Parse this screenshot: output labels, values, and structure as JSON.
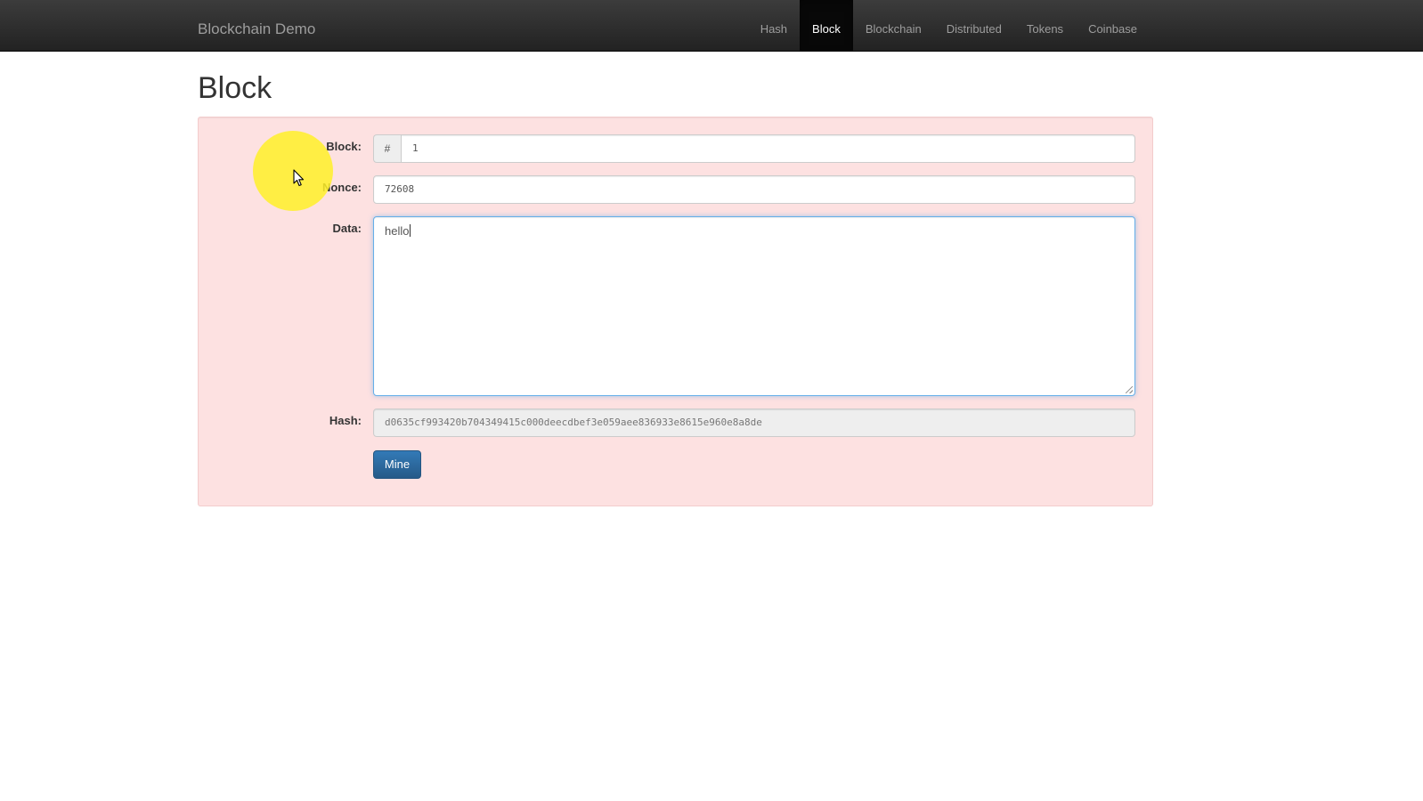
{
  "navbar": {
    "brand": "Blockchain Demo",
    "items": [
      {
        "label": "Hash",
        "active": false
      },
      {
        "label": "Block",
        "active": true
      },
      {
        "label": "Blockchain",
        "active": false
      },
      {
        "label": "Distributed",
        "active": false
      },
      {
        "label": "Tokens",
        "active": false
      },
      {
        "label": "Coinbase",
        "active": false
      }
    ]
  },
  "page": {
    "title": "Block"
  },
  "form": {
    "block_label": "Block:",
    "block_prefix": "#",
    "block_value": "1",
    "nonce_label": "Nonce:",
    "nonce_value": "72608",
    "data_label": "Data:",
    "data_value": "hello",
    "hash_label": "Hash:",
    "hash_value": "d0635cf993420b704349415c000deecdbef3e059aee836933e8615e960e8a8de",
    "mine_label": "Mine"
  },
  "colors": {
    "navbar_bg": "#222222",
    "well_invalid_bg": "#fde1e1",
    "button_primary": "#337ab7",
    "cursor_highlight": "#fff028"
  },
  "icons": {
    "cursor": "mouse-pointer-icon",
    "resize": "resize-handle-icon"
  }
}
